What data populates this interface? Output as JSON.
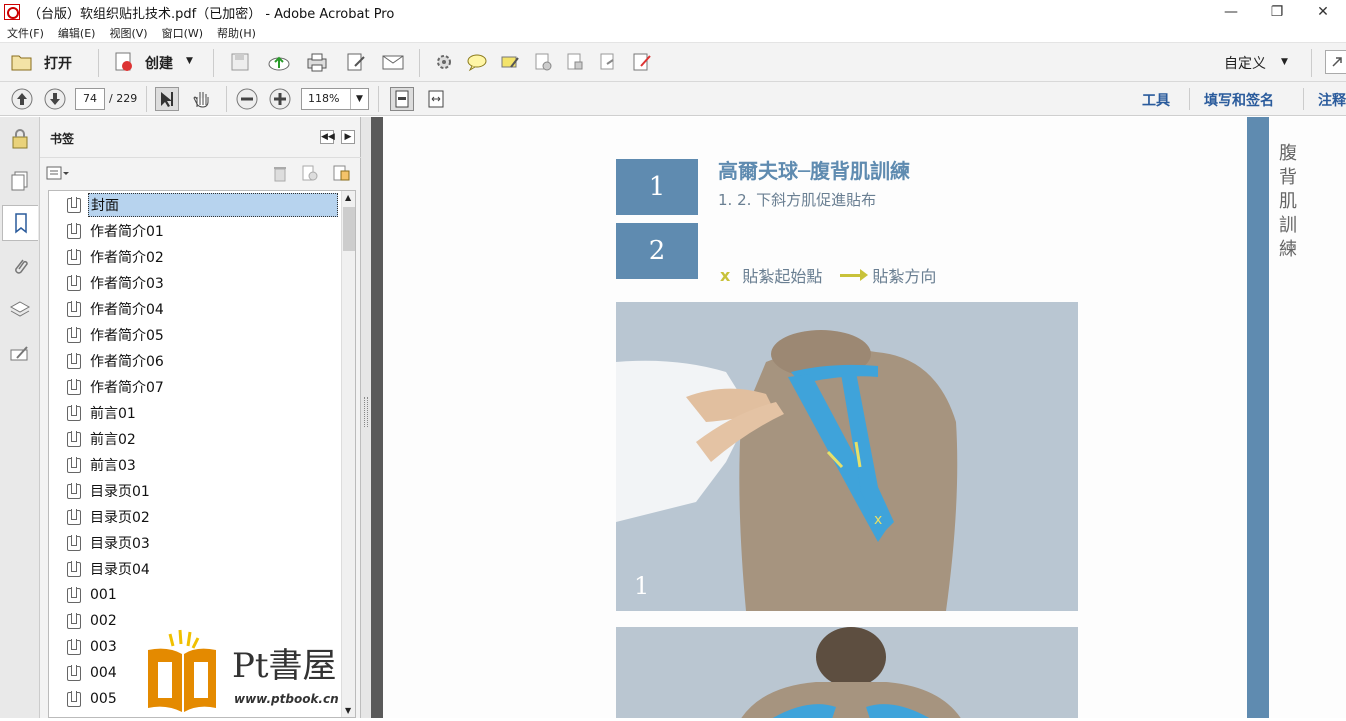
{
  "window": {
    "title": "（台版）软组织贴扎技术.pdf（已加密） - Adobe Acrobat Pro",
    "buttons": [
      "—",
      "❐",
      "✕"
    ]
  },
  "menu": [
    "文件(F)",
    "编辑(E)",
    "视图(V)",
    "窗口(W)",
    "帮助(H)"
  ],
  "toolbar": {
    "open_label": "打开",
    "create_label": "创建",
    "customize_label": "自定义"
  },
  "nav": {
    "page_current": "74",
    "page_total": "/ 229",
    "zoom": "118%"
  },
  "right_links": {
    "tools": "工具",
    "fill_sign": "填写和签名",
    "comment": "注释"
  },
  "panel": {
    "title": "书签"
  },
  "bookmarks": [
    "封面",
    "作者简介01",
    "作者简介02",
    "作者简介03",
    "作者简介04",
    "作者简介05",
    "作者简介06",
    "作者简介07",
    "前言01",
    "前言02",
    "前言03",
    "目录页01",
    "目录页02",
    "目录页03",
    "目录页04",
    "001",
    "002",
    "003",
    "004",
    "005"
  ],
  "document": {
    "num1": "1",
    "num2": "2",
    "heading": "高爾夫球─腹背肌訓練",
    "subheading": "1. 2. 下斜方肌促進貼布",
    "legend_x": "x",
    "legend_start": "貼紮起始點",
    "legend_direction": "貼紮方向",
    "photo_label": "1",
    "photo_mark": "x",
    "side_text": "腹背肌訓練"
  },
  "watermark": {
    "name": "Pt書屋",
    "url": "www.ptbook.cn"
  },
  "colors": {
    "accent_blue": "#5f8bb0",
    "tape_blue": "#3fa3da",
    "legend_yellow": "#c8c23a",
    "link_blue": "#2a5b9c"
  }
}
